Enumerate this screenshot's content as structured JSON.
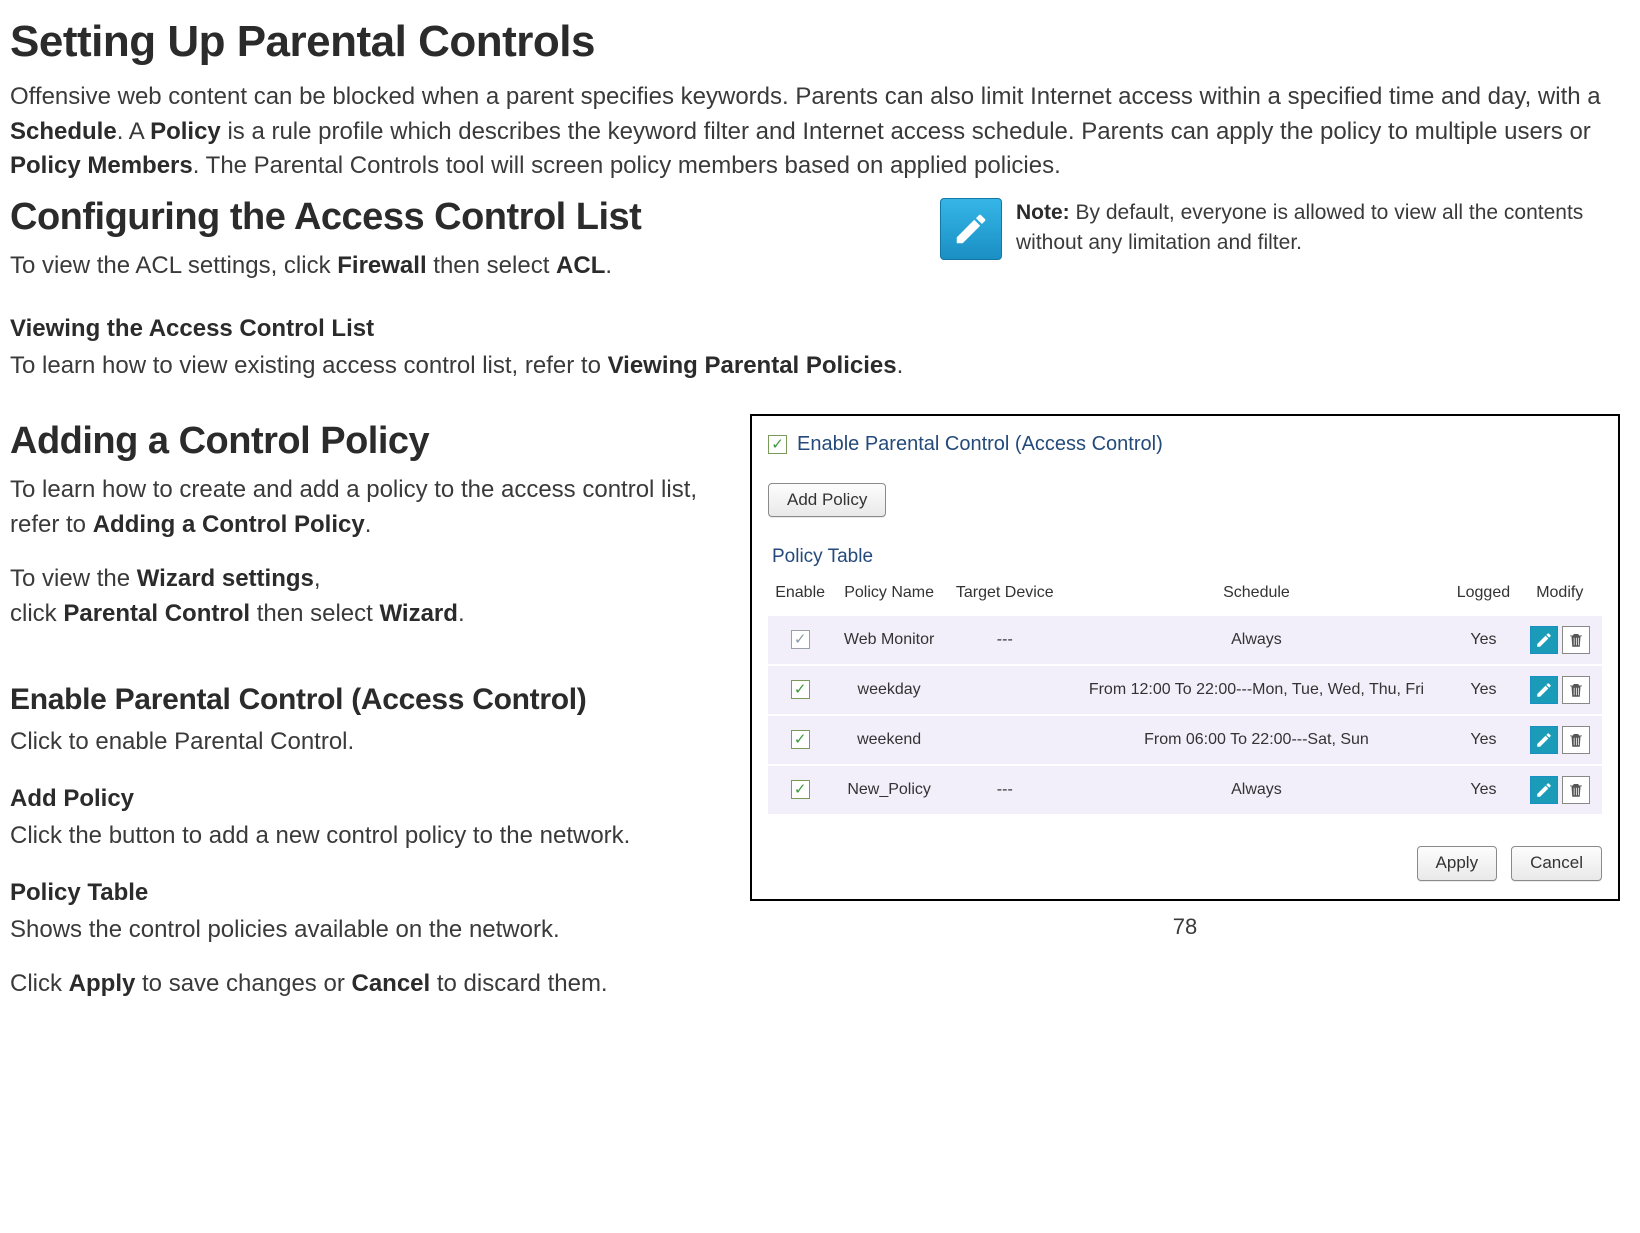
{
  "title": "Setting Up Parental Controls",
  "intro_html": "Offensive web content can be blocked when a parent specifies keywords. Parents can also limit Internet access within a specified time and day, with a <b>Schedule</b>. A <b>Policy</b> is a rule profile which describes the keyword filter and Internet access schedule. Parents can apply the policy to multiple users or <b>Policy Members</b>. The Parental Controls tool will screen policy members based on applied policies.",
  "acl": {
    "heading": "Configuring the Access Control List",
    "subtext_html": "To view the ACL settings, click <b>Firewall</b> then select <b>ACL</b>."
  },
  "note": {
    "label": "Note:",
    "text": "By default, everyone is allowed to view all the contents without any limitation and filter."
  },
  "view_acl": {
    "heading": "Viewing the Access Control List",
    "text_html": "To learn how to view existing access control list, refer to <b>Viewing Parental Policies</b>."
  },
  "add_policy_section": {
    "heading": "Adding a Control Policy",
    "p1_html": "To learn how to create and add a policy to the access control list, refer to <b>Adding a Control Policy</b>.",
    "p2_html": "To view the <b>Wizard settings</b>,<br>click <b>Parental Control</b> then select <b>Wizard</b>."
  },
  "enable_section": {
    "heading": "Enable Parental Control (Access Control)",
    "text": "Click to enable Parental Control."
  },
  "add_policy_sub": {
    "heading": "Add Policy",
    "text": "Click the button to add a new control policy to the network."
  },
  "policy_table_sub": {
    "heading": "Policy Table",
    "text": "Shows the control policies available on the network."
  },
  "apply_cancel_html": "Click <b>Apply</b> to save changes or <b>Cancel</b> to discard them.",
  "page_number": "78",
  "ui": {
    "enable_label": "Enable Parental Control (Access Control)",
    "add_policy_btn": "Add Policy",
    "policy_table_label": "Policy Table",
    "headers": {
      "enable": "Enable",
      "policy_name": "Policy Name",
      "target_device": "Target Device",
      "schedule": "Schedule",
      "logged": "Logged",
      "modify": "Modify"
    },
    "rows": [
      {
        "enabled": true,
        "gray": true,
        "name": "Web Monitor",
        "target": "---",
        "schedule": "Always",
        "logged": "Yes"
      },
      {
        "enabled": true,
        "gray": false,
        "name": "weekday",
        "target": "",
        "schedule": "From 12:00 To 22:00---Mon, Tue, Wed, Thu, Fri",
        "logged": "Yes"
      },
      {
        "enabled": true,
        "gray": false,
        "name": "weekend",
        "target": "",
        "schedule": "From 06:00 To 22:00---Sat, Sun",
        "logged": "Yes"
      },
      {
        "enabled": true,
        "gray": false,
        "name": "New_Policy",
        "target": "---",
        "schedule": "Always",
        "logged": "Yes"
      }
    ],
    "apply_btn": "Apply",
    "cancel_btn": "Cancel"
  }
}
